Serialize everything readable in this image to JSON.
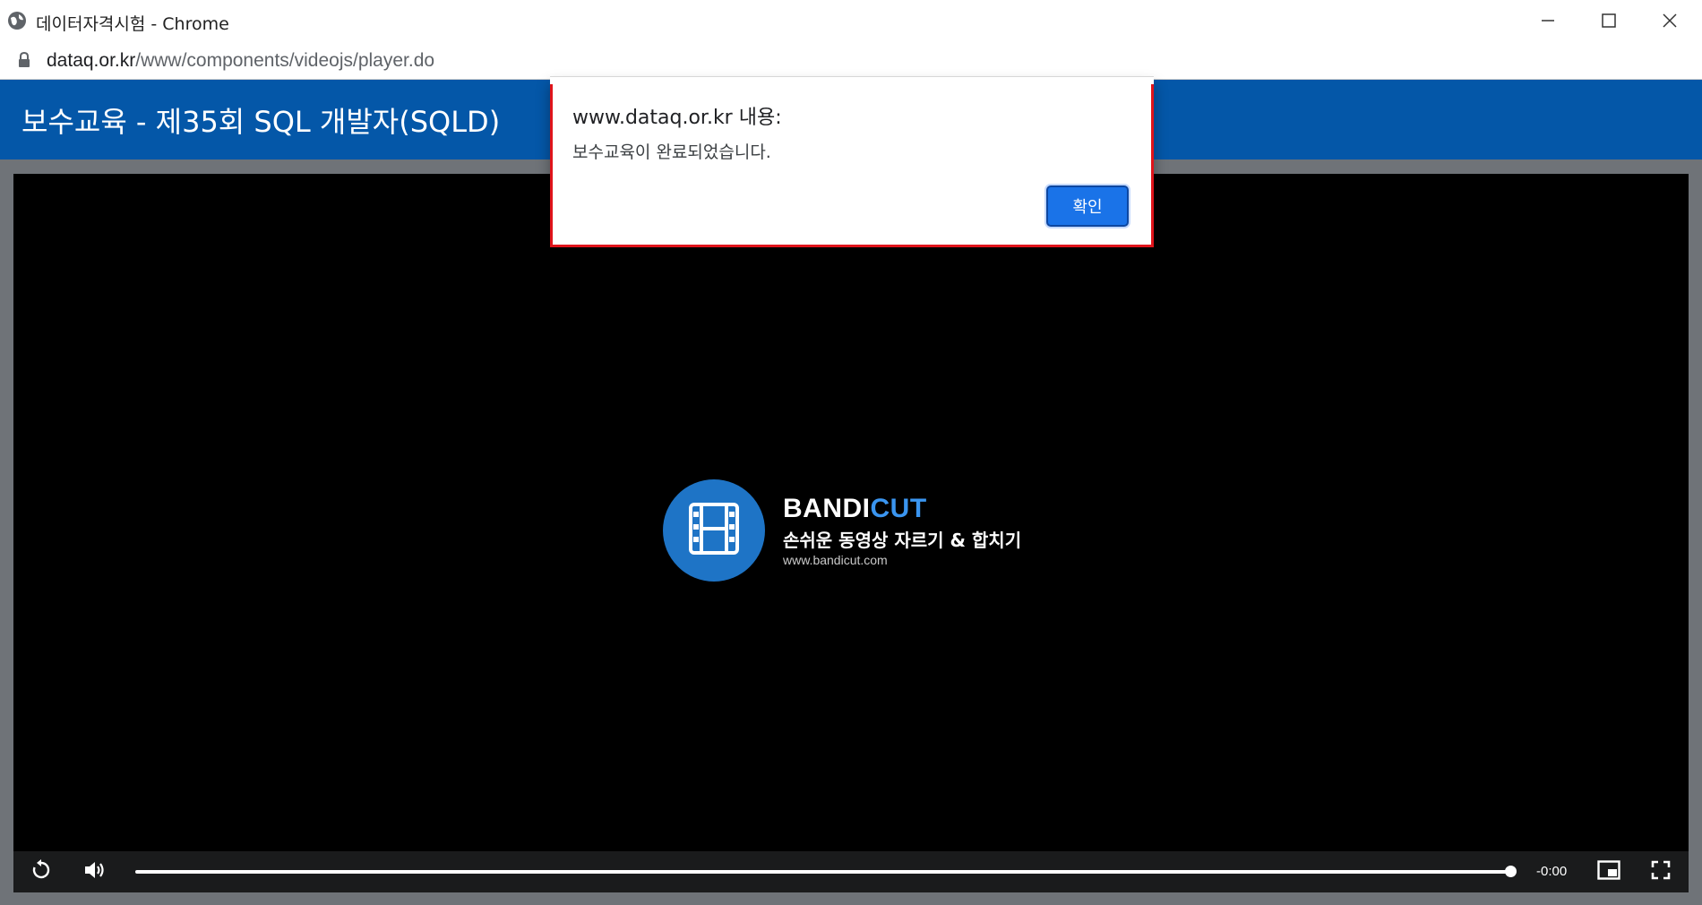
{
  "window": {
    "title": "데이터자격시험 - Chrome",
    "controls": [
      "minimize-icon",
      "maximize-icon",
      "close-icon"
    ]
  },
  "address_bar": {
    "host": "dataq.or.kr",
    "path": "/www/components/videojs/player.do"
  },
  "page": {
    "title": "보수교육 - 제35회 SQL 개발자(SQLD)"
  },
  "watermark": {
    "brand_part1": "BANDI",
    "brand_part2": "CUT",
    "slogan": "손쉬운 동영상 자르기 & 합치기",
    "site": "www.bandicut.com",
    "colors": {
      "circle": "#1e74c6",
      "accent": "#3a95f0"
    }
  },
  "player": {
    "time_remaining": "-0:00",
    "progress_fraction": 1.0,
    "icons": [
      "replay-icon",
      "volume-icon",
      "picture-in-picture-icon",
      "fullscreen-icon"
    ]
  },
  "dialog": {
    "heading": "www.dataq.or.kr 내용:",
    "message": "보수교육이 완료되었습니다.",
    "ok_label": "확인",
    "border_color": "#e0141b"
  }
}
